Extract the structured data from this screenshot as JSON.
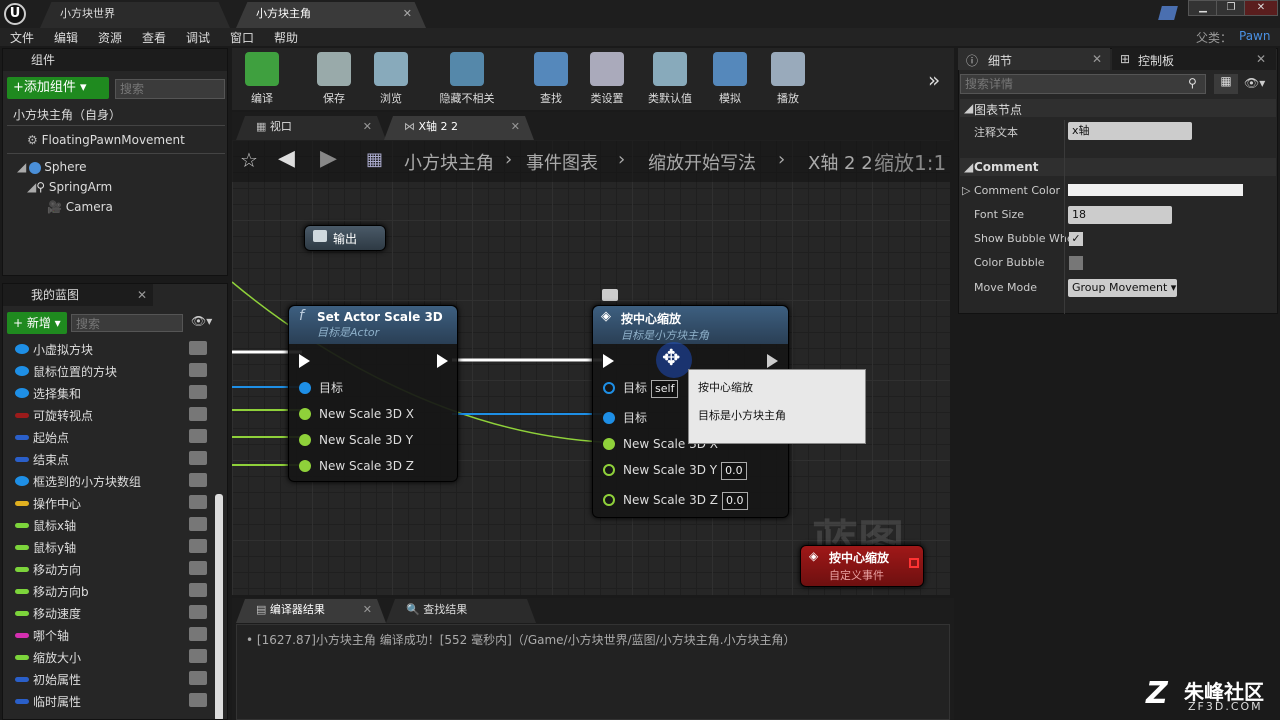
{
  "titlebar": {
    "tab1": "小方块世界",
    "tab2": "小方块主角",
    "parent_label": "父类：",
    "parent_value": "Pawn"
  },
  "menu": [
    "文件",
    "编辑",
    "资源",
    "查看",
    "调试",
    "窗口",
    "帮助"
  ],
  "components": {
    "title": "组件",
    "add_button": "+添加组件 ▾",
    "search_placeholder": "搜索",
    "self": "小方块主角（自身）",
    "items": [
      "FloatingPawnMovement",
      "Sphere",
      "SpringArm",
      "Camera"
    ]
  },
  "myblueprint": {
    "title": "我的蓝图",
    "new_button": "+ 新增 ▾",
    "search_placeholder": "搜索",
    "vars": [
      {
        "name": "小虚拟方块",
        "color": "#1e8fe6"
      },
      {
        "name": "鼠标位置的方块",
        "color": "#1e8fe6"
      },
      {
        "name": "选择集和",
        "color": "#1e8fe6"
      },
      {
        "name": "可旋转视点",
        "color": "#9b1b1b"
      },
      {
        "name": "起始点",
        "color": "#2a5fc9"
      },
      {
        "name": "结束点",
        "color": "#2a5fc9"
      },
      {
        "name": "框选到的小方块数组",
        "color": "#1e8fe6"
      },
      {
        "name": "操作中心",
        "color": "#e0b020"
      },
      {
        "name": "鼠标x轴",
        "color": "#7cd43b"
      },
      {
        "name": "鼠标y轴",
        "color": "#7cd43b"
      },
      {
        "name": "移动方向",
        "color": "#7cd43b"
      },
      {
        "name": "移动方向b",
        "color": "#7cd43b"
      },
      {
        "name": "移动速度",
        "color": "#7cd43b"
      },
      {
        "name": "哪个轴",
        "color": "#d42fb0"
      },
      {
        "name": "缩放大小",
        "color": "#7cd43b"
      },
      {
        "name": "初始属性",
        "color": "#2a5fc9"
      },
      {
        "name": "临时属性",
        "color": "#2a5fc9"
      }
    ]
  },
  "toolbar": [
    "编译",
    "保存",
    "浏览",
    "隐藏不相关",
    "查找",
    "类设置",
    "类默认值",
    "模拟",
    "播放"
  ],
  "viewtabs": {
    "tab1": "视口",
    "tab2": "X轴 2 2"
  },
  "breadcrumb": {
    "b1": "小方块主角",
    "b2": "事件图表",
    "b3": "缩放开始写法",
    "b4": "X轴 2 2",
    "zoom": "缩放1:1"
  },
  "graph": {
    "output_node": "输出",
    "set_node": {
      "title": "Set Actor Scale 3D",
      "subtitle": "目标是Actor",
      "pins": [
        "目标",
        "New Scale 3D X",
        "New Scale 3D Y",
        "New Scale 3D Z"
      ]
    },
    "center_node": {
      "title": "按中心缩放",
      "subtitle": "目标是小方块主角",
      "self_value": "self",
      "pins": [
        "目标",
        "目标",
        "New Scale 3D X",
        "New Scale 3D Y",
        "New Scale 3D Z"
      ],
      "y_val": "0.0",
      "z_val": "0.0"
    },
    "tooltip": {
      "line1": "按中心缩放",
      "line2": "目标是小方块主角"
    },
    "event_node": {
      "title": "按中心缩放",
      "subtitle": "自定义事件"
    },
    "watermark": "蓝图"
  },
  "bottom": {
    "tab1": "编译器结果",
    "tab2": "查找结果",
    "log": "[1627.87]小方块主角 编译成功！[552 毫秒内]（/Game/小方块世界/蓝图/小方块主角.小方块主角）"
  },
  "details": {
    "tab1": "细节",
    "tab2": "控制板",
    "search_placeholder": "搜索详情",
    "section1": "图表节点",
    "comment_text_label": "注释文本",
    "comment_text_value": "x轴",
    "section2": "Comment",
    "comment_color": "Comment Color",
    "font_size": "Font Size",
    "font_size_value": "18",
    "show_bubble": "Show Bubble When",
    "color_bubble": "Color Bubble",
    "move_mode": "Move Mode",
    "move_mode_value": "Group Movement ▾"
  },
  "brand": {
    "name": "朱峰社区",
    "url": "ZF3D.COM"
  }
}
